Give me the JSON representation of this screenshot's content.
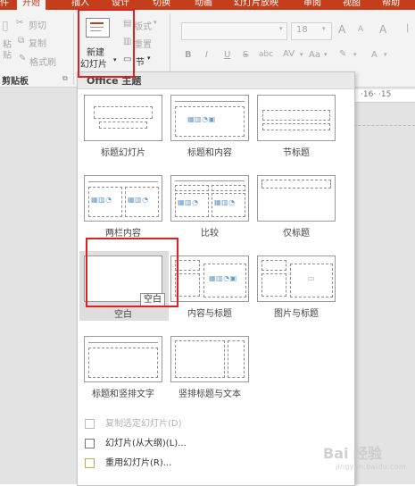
{
  "tabs": [
    "件",
    "开始",
    "插入",
    "设计",
    "切换",
    "动画",
    "幻灯片放映",
    "审阅",
    "视图",
    "帮助"
  ],
  "clipboard": {
    "cut": "剪切",
    "copy": "复制",
    "paste": "粘",
    "paste_sub": "贴",
    "format_painter": "格式刷",
    "group_label": "剪贴板"
  },
  "slides_group": {
    "new_slide_line1": "新建",
    "new_slide_line2": "幻灯片",
    "layout": "版式",
    "reset": "重置",
    "section": "节"
  },
  "font": {
    "size": "18",
    "bold": "B",
    "italic": "I",
    "underline": "U",
    "strike": "S",
    "shadow": "abc",
    "spacing": "AV",
    "case": "Aa",
    "grow": "A",
    "shrink": "A",
    "clear": "A",
    "font_color": "A"
  },
  "ruler": {
    "text": "·16· ·15"
  },
  "gallery": {
    "header": "Office 主题",
    "layouts": [
      "标题幻灯片",
      "标题和内容",
      "节标题",
      "两栏内容",
      "比较",
      "仅标题",
      "空白",
      "内容与标题",
      "图片与标题",
      "标题和竖排文字",
      "竖排标题与文本"
    ],
    "tooltip": "空白",
    "hovered": "空白"
  },
  "menu": {
    "duplicate": "复制选定幻灯片(D)",
    "from_outline": "幻灯片(从大纲)(L)...",
    "reuse": "重用幻灯片(R)..."
  },
  "watermark": {
    "brand": "Bai 经验",
    "url": "jingyan.baidu.com"
  },
  "colors": {
    "ribbon_accent": "#c43e1c",
    "highlight_box": "#e02020",
    "hover_bg": "#dedede"
  }
}
